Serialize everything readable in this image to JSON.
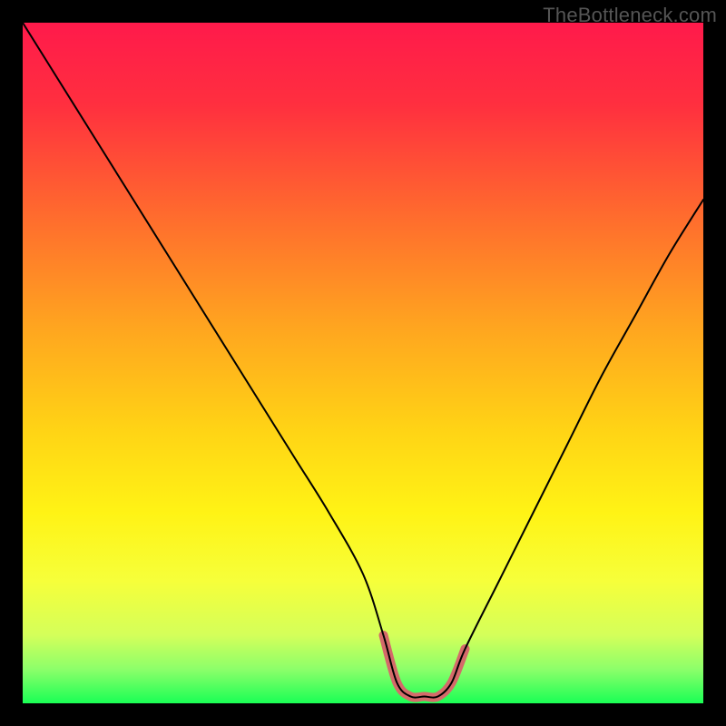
{
  "watermark": "TheBottleneck.com",
  "chart_data": {
    "type": "line",
    "title": "",
    "xlabel": "",
    "ylabel": "",
    "xlim": [
      0,
      100
    ],
    "ylim": [
      0,
      100
    ],
    "series": [
      {
        "name": "bottleneck-curve",
        "x": [
          0,
          5,
          10,
          15,
          20,
          25,
          30,
          35,
          40,
          45,
          50,
          53,
          55,
          57,
          59,
          61,
          63,
          65,
          70,
          75,
          80,
          85,
          90,
          95,
          100
        ],
        "values": [
          100,
          92,
          84,
          76,
          68,
          60,
          52,
          44,
          36,
          28,
          19,
          10,
          3,
          1,
          1,
          1,
          3,
          8,
          18,
          28,
          38,
          48,
          57,
          66,
          74
        ]
      },
      {
        "name": "floor-highlight",
        "x": [
          53,
          55,
          57,
          59,
          61,
          63,
          65
        ],
        "values": [
          10,
          3,
          1,
          1,
          1,
          3,
          8
        ]
      }
    ],
    "gradient_stops": [
      {
        "offset": 0.0,
        "color": "#ff1a4b"
      },
      {
        "offset": 0.12,
        "color": "#ff2f3f"
      },
      {
        "offset": 0.28,
        "color": "#ff6a2e"
      },
      {
        "offset": 0.45,
        "color": "#ffa61f"
      },
      {
        "offset": 0.6,
        "color": "#ffd415"
      },
      {
        "offset": 0.72,
        "color": "#fff315"
      },
      {
        "offset": 0.82,
        "color": "#f6ff3a"
      },
      {
        "offset": 0.9,
        "color": "#d4ff5a"
      },
      {
        "offset": 0.95,
        "color": "#8cff6a"
      },
      {
        "offset": 1.0,
        "color": "#1aff55"
      }
    ],
    "colors": {
      "curve": "#000000",
      "highlight": "#d46a6a"
    }
  }
}
